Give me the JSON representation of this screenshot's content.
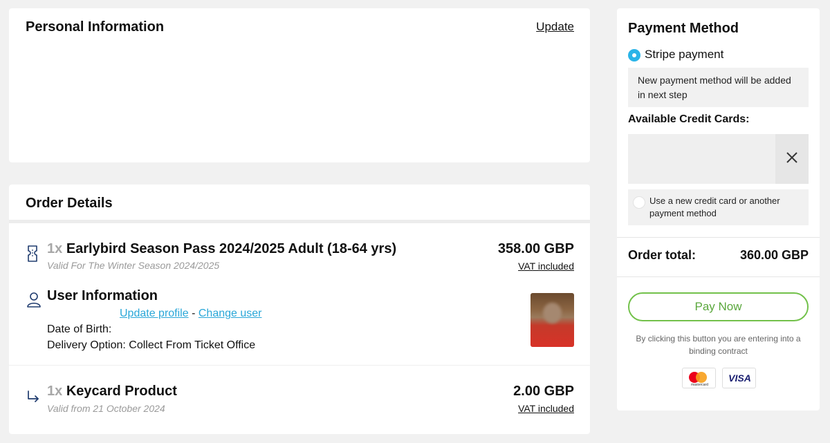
{
  "personal": {
    "title": "Personal Information",
    "update_label": "Update"
  },
  "order": {
    "title": "Order Details",
    "items": [
      {
        "qty": "1x",
        "name": "Earlybird Season Pass 2024/2025 Adult (18-64 yrs)",
        "subtitle": "Valid For The Winter Season 2024/2025",
        "price": "358.00 GBP",
        "vat": "VAT included",
        "icon": "ticket-icon"
      },
      {
        "qty": "1x",
        "name": "Keycard Product",
        "subtitle": "Valid from 21 October 2024",
        "price": "2.00 GBP",
        "vat": "VAT included",
        "icon": "sub-item-arrow-icon"
      }
    ],
    "user": {
      "title": "User Information",
      "update_profile": "Update profile",
      "separator": "-",
      "change_user": "Change user",
      "dob_label": "Date of Birth:",
      "delivery": "Delivery Option: Collect From Ticket Office",
      "icon": "user-icon"
    }
  },
  "payment": {
    "title": "Payment Method",
    "option_label": "Stripe payment",
    "notice": "New payment method will be added in next step",
    "available_cards_label": "Available Credit Cards:",
    "new_card_label": "Use a new credit card or another payment method",
    "total_label": "Order total:",
    "total_value": "360.00 GBP",
    "pay_button": "Pay Now",
    "legal_text": "By clicking this button you are entering into a binding contract",
    "card_logos": {
      "mastercard_text": "mastercard",
      "visa_text": "VISA"
    },
    "colors": {
      "accent_blue": "#2ab4e8",
      "pay_green": "#72c14a",
      "link_blue": "#2aa7d8"
    }
  }
}
